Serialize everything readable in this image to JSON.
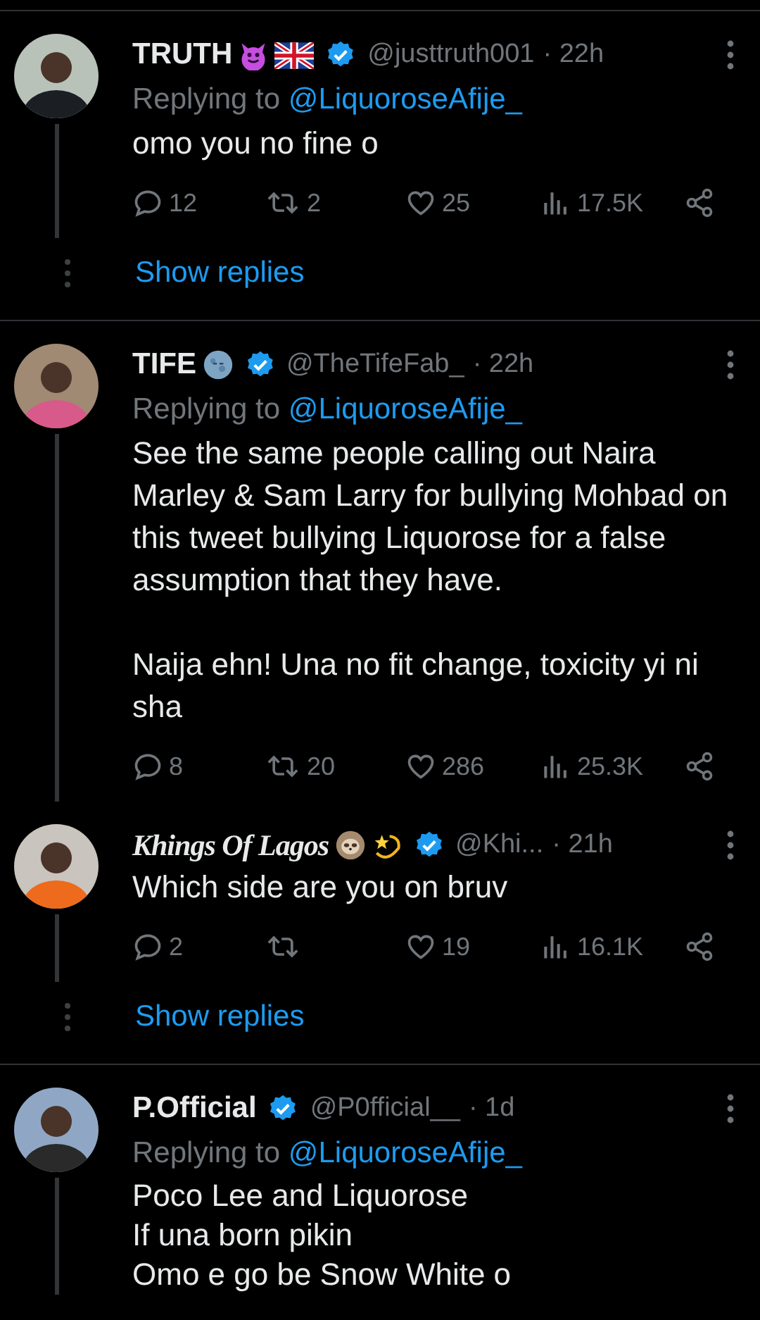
{
  "tweets": [
    {
      "name": "TRUTH",
      "name_fancy": false,
      "name_icons": [
        {
          "kind": "devil"
        },
        {
          "kind": "uk-flag"
        }
      ],
      "verified": true,
      "handle": "@justtruth001",
      "time": "· 22h",
      "replying_label": "Replying to",
      "replying_to": "@LiquoroseAfije_",
      "paragraphs": [
        "omo you no fine o"
      ],
      "actions": {
        "replies": "12",
        "reposts": "2",
        "likes": "25",
        "views": "17.5K"
      },
      "thread_below": true,
      "show_replies": "Show replies",
      "divider_below": true
    },
    {
      "name": "TIFE",
      "name_fancy": false,
      "name_icons": [
        {
          "kind": "moon"
        }
      ],
      "verified": true,
      "handle": "@TheTifeFab_",
      "time": "· 22h",
      "replying_label": "Replying to",
      "replying_to": "@LiquoroseAfije_",
      "paragraphs": [
        "See the same people calling out Naira Marley & Sam Larry for bullying Mohbad on this tweet bullying Liquorose for a false assumption that they have.",
        "Naija ehn! Una no fit change, toxicity yi ni sha"
      ],
      "actions": {
        "replies": "8",
        "reposts": "20",
        "likes": "286",
        "views": "25.3K"
      },
      "thread_below": true,
      "divider_below": false
    },
    {
      "name": "Khings Of Lagos",
      "name_fancy": true,
      "name_icons": [
        {
          "kind": "sloth"
        },
        {
          "kind": "dizzy"
        }
      ],
      "verified": true,
      "handle": "@Khi...",
      "time": "· 21h",
      "paragraphs": [
        "Which side are you on bruv"
      ],
      "actions": {
        "replies": "2",
        "likes": "19",
        "views": "16.1K"
      },
      "thread_below": true,
      "show_replies": "Show replies",
      "divider_below": true
    },
    {
      "name": "P.Official",
      "name_fancy": false,
      "verified": true,
      "handle": "@P0fficial__",
      "time": "· 1d",
      "replying_label": "Replying to",
      "replying_to": "@LiquoroseAfije_",
      "paragraphs": [
        "Poco Lee and Liquorose\nIf una born pikin\nOmo e go be Snow White o"
      ],
      "thread_below": true,
      "divider_below": false
    }
  ]
}
